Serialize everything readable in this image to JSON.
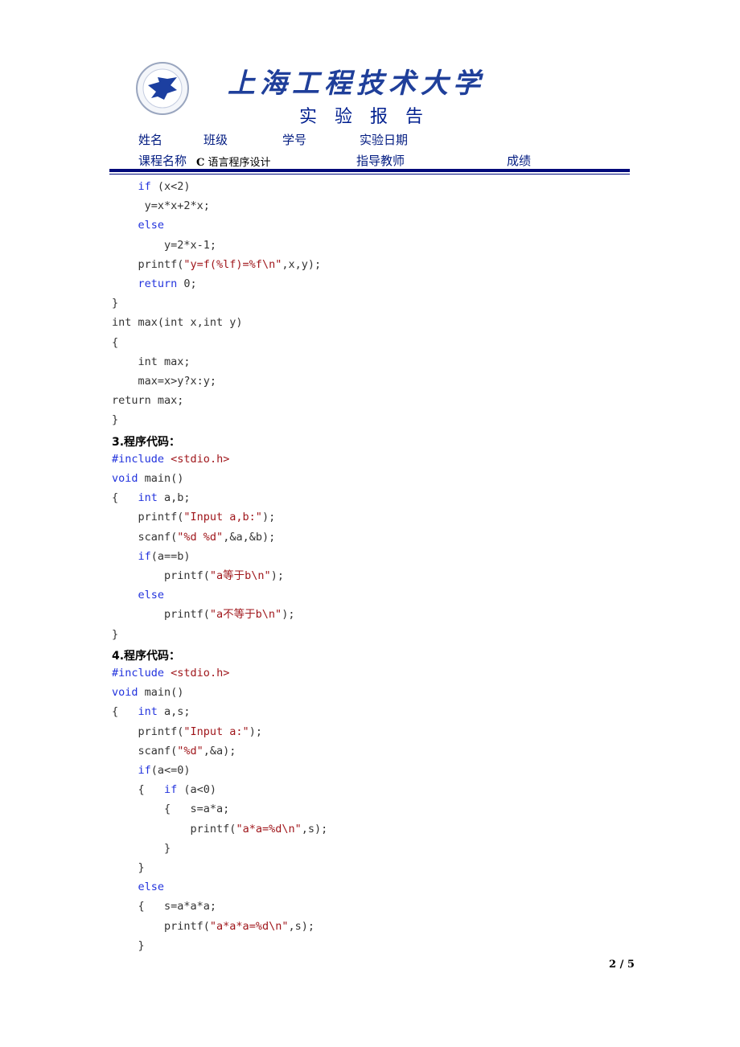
{
  "header": {
    "university_name": "上海工程技术大学",
    "report_title": "实验报告",
    "fields": {
      "name_label": "姓名",
      "class_label": "班级",
      "student_id_label": "学号",
      "date_label": "实验日期",
      "course_label": "课程名称",
      "course_value_prefix": "C",
      "course_value": "语言程序设计",
      "instructor_label": "指导教师",
      "grade_label": "成绩"
    },
    "colors": {
      "title": "#1f3f9a",
      "labels": "#001a80",
      "rule": "#000a7a"
    }
  },
  "code_colors": {
    "keyword": "#2233dd",
    "string": "#a0171c",
    "plain": "#333333"
  },
  "blocks": [
    {
      "heading": "",
      "lines": [
        [
          [
            "    ",
            ""
          ],
          [
            "if",
            "kw"
          ],
          [
            " (x<2)",
            ""
          ]
        ],
        [
          [
            "     y=x*x+2*x;",
            ""
          ]
        ],
        [
          [
            "    ",
            ""
          ],
          [
            "else",
            "kw"
          ]
        ],
        [
          [
            "        y=2*x-1;",
            ""
          ]
        ],
        [
          [
            "    printf(",
            ""
          ],
          [
            "\"y=f(%lf)=%f\\n\"",
            "str"
          ],
          [
            ",x,y);",
            ""
          ]
        ],
        [
          [
            "    ",
            ""
          ],
          [
            "return",
            "kw"
          ],
          [
            " 0;",
            ""
          ]
        ],
        [
          [
            "}",
            ""
          ]
        ],
        [
          [
            "int max(int x,int y)",
            ""
          ]
        ],
        [
          [
            "{",
            ""
          ]
        ],
        [
          [
            "    int max;",
            ""
          ]
        ],
        [
          [
            "    max=x>y?x:y;",
            ""
          ]
        ],
        [
          [
            "return max;",
            ""
          ]
        ],
        [
          [
            "}",
            ""
          ]
        ]
      ]
    },
    {
      "heading": "3.程序代码：",
      "lines": [
        [
          [
            "#include",
            "kw"
          ],
          [
            " ",
            ""
          ],
          [
            "<stdio.h>",
            "str"
          ]
        ],
        [
          [
            "void",
            "kw"
          ],
          [
            " main()",
            ""
          ]
        ],
        [
          [
            "{   ",
            ""
          ],
          [
            "int",
            "kw"
          ],
          [
            " a,b;",
            ""
          ]
        ],
        [
          [
            "    printf(",
            ""
          ],
          [
            "\"Input a,b:\"",
            "str"
          ],
          [
            ");",
            ""
          ]
        ],
        [
          [
            "    scanf(",
            ""
          ],
          [
            "\"%d %d\"",
            "str"
          ],
          [
            ",&a,&b);",
            ""
          ]
        ],
        [
          [
            "    ",
            ""
          ],
          [
            "if",
            "kw"
          ],
          [
            "(a==b)",
            ""
          ]
        ],
        [
          [
            "        printf(",
            ""
          ],
          [
            "\"a等于b\\n\"",
            "str"
          ],
          [
            ");",
            ""
          ]
        ],
        [
          [
            "    ",
            ""
          ],
          [
            "else",
            "kw"
          ]
        ],
        [
          [
            "        printf(",
            ""
          ],
          [
            "\"a不等于b\\n\"",
            "str"
          ],
          [
            ");",
            ""
          ]
        ],
        [
          [
            "}",
            ""
          ]
        ]
      ]
    },
    {
      "heading": "4.程序代码：",
      "lines": [
        [
          [
            "#include",
            "kw"
          ],
          [
            " ",
            ""
          ],
          [
            "<stdio.h>",
            "str"
          ]
        ],
        [
          [
            "void",
            "kw"
          ],
          [
            " main()",
            ""
          ]
        ],
        [
          [
            "{   ",
            ""
          ],
          [
            "int",
            "kw"
          ],
          [
            " a,s;",
            ""
          ]
        ],
        [
          [
            "    printf(",
            ""
          ],
          [
            "\"Input a:\"",
            "str"
          ],
          [
            ");",
            ""
          ]
        ],
        [
          [
            "    scanf(",
            ""
          ],
          [
            "\"%d\"",
            "str"
          ],
          [
            ",&a);",
            ""
          ]
        ],
        [
          [
            "    ",
            ""
          ],
          [
            "if",
            "kw"
          ],
          [
            "(a<=0)",
            ""
          ]
        ],
        [
          [
            "    {   ",
            ""
          ],
          [
            "if",
            "kw"
          ],
          [
            " (a<0)",
            ""
          ]
        ],
        [
          [
            "        {   s=a*a;",
            ""
          ]
        ],
        [
          [
            "            printf(",
            ""
          ],
          [
            "\"a*a=%d\\n\"",
            "str"
          ],
          [
            ",s);",
            ""
          ]
        ],
        [
          [
            "        }",
            ""
          ]
        ],
        [
          [
            "    }",
            ""
          ]
        ],
        [
          [
            "    ",
            ""
          ],
          [
            "else",
            "kw"
          ]
        ],
        [
          [
            "    {   s=a*a*a;",
            ""
          ]
        ],
        [
          [
            "        printf(",
            ""
          ],
          [
            "\"a*a*a=%d\\n\"",
            "str"
          ],
          [
            ",s);",
            ""
          ]
        ],
        [
          [
            "    }",
            ""
          ]
        ]
      ]
    }
  ],
  "footer": {
    "page_number": "2 / 5"
  }
}
